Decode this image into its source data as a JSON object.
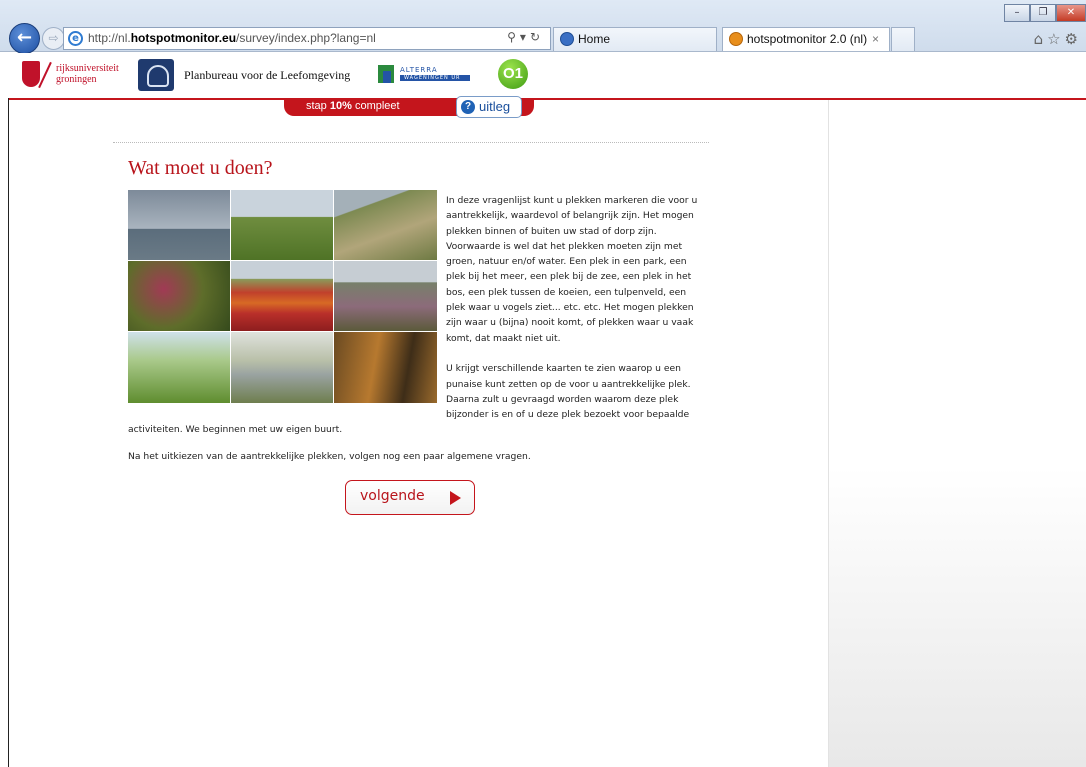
{
  "browser": {
    "url_prefix": "http://nl.",
    "url_domain": "hotspotmonitor.eu",
    "url_path": "/survey/index.php?lang=nl",
    "tabs": [
      {
        "label": "Home"
      },
      {
        "label": "hotspotmonitor 2.0 (nl)",
        "close": "×"
      }
    ]
  },
  "header": {
    "rug_line1": "rijksuniversiteit",
    "rug_line2": "groningen",
    "pbl_name": "Planbureau voor de Leefomgeving",
    "alterra_name": "ALTERRA",
    "alterra_sub": "WAGENINGEN UR",
    "o1_label": "O1"
  },
  "progress": {
    "prefix": "stap ",
    "percent": "10%",
    "suffix": " compleet",
    "value": 0.1
  },
  "uitleg_label": "uitleg",
  "main": {
    "title": "Wat moet u doen?",
    "paragraph1": "In deze vragenlijst kunt u plekken markeren die voor u aantrekkelijk, waardevol of belangrijk zijn. Het mogen plekken binnen of buiten uw stad of dorp zijn. Voorwaarde is wel dat het plekken moeten zijn met groen, natuur en/of water. Een plek in een park, een plek bij het meer, een plek bij de zee, een plek in het bos, een plek tussen de koeien, een tulpenveld, een plek waar u vogels ziet... etc. etc. Het mogen plekken zijn waar u (bijna) nooit komt, of plekken waar u vaak komt, dat maakt niet uit.",
    "paragraph2": "U krijgt verschillende kaarten te zien waarop u een punaise kunt zetten op de voor u aantrekkelijke plek. Daarna zult u gevraagd worden waarom deze plek bijzonder is en of u deze plek bezoekt voor bepaalde activiteiten. We beginnen met uw eigen buurt.",
    "paragraph3": "Na het uitkiezen van de aantrekkelijke plekken, volgen nog een paar algemene vragen.",
    "next_label": "volgende"
  },
  "colors": {
    "accent": "#c4151c",
    "heading": "#b8141b",
    "link_blue": "#1a4f9c"
  }
}
